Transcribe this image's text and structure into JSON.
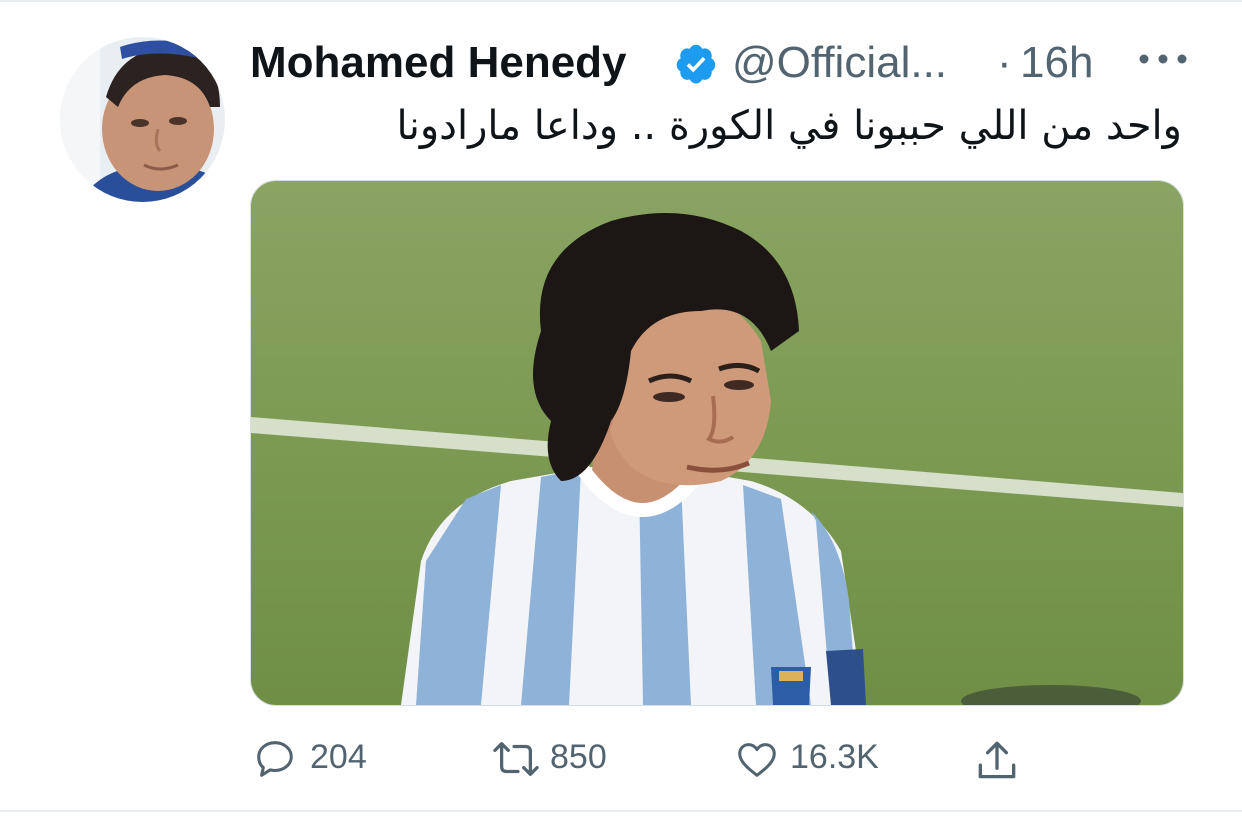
{
  "tweet": {
    "author": {
      "display_name": "Mohamed Henedy",
      "handle": "@Official...",
      "verified": true
    },
    "separator": "·",
    "time": "16h",
    "text": "واحد من اللي حببونا في الكورة .. وداعا مارادونا",
    "metrics": {
      "replies": "204",
      "retweets": "850",
      "likes": "16.3K"
    }
  },
  "icons": {
    "verified": "verified-badge-icon",
    "more": "more-options-icon",
    "reply": "reply-icon",
    "retweet": "retweet-icon",
    "like": "heart-icon",
    "share": "share-icon"
  },
  "colors": {
    "verified_blue": "#1d9bf0",
    "secondary_text": "#536471",
    "primary_text": "#0f1419",
    "pitch_green": "#7c9a52",
    "jersey_blue": "#8fb2d9"
  }
}
